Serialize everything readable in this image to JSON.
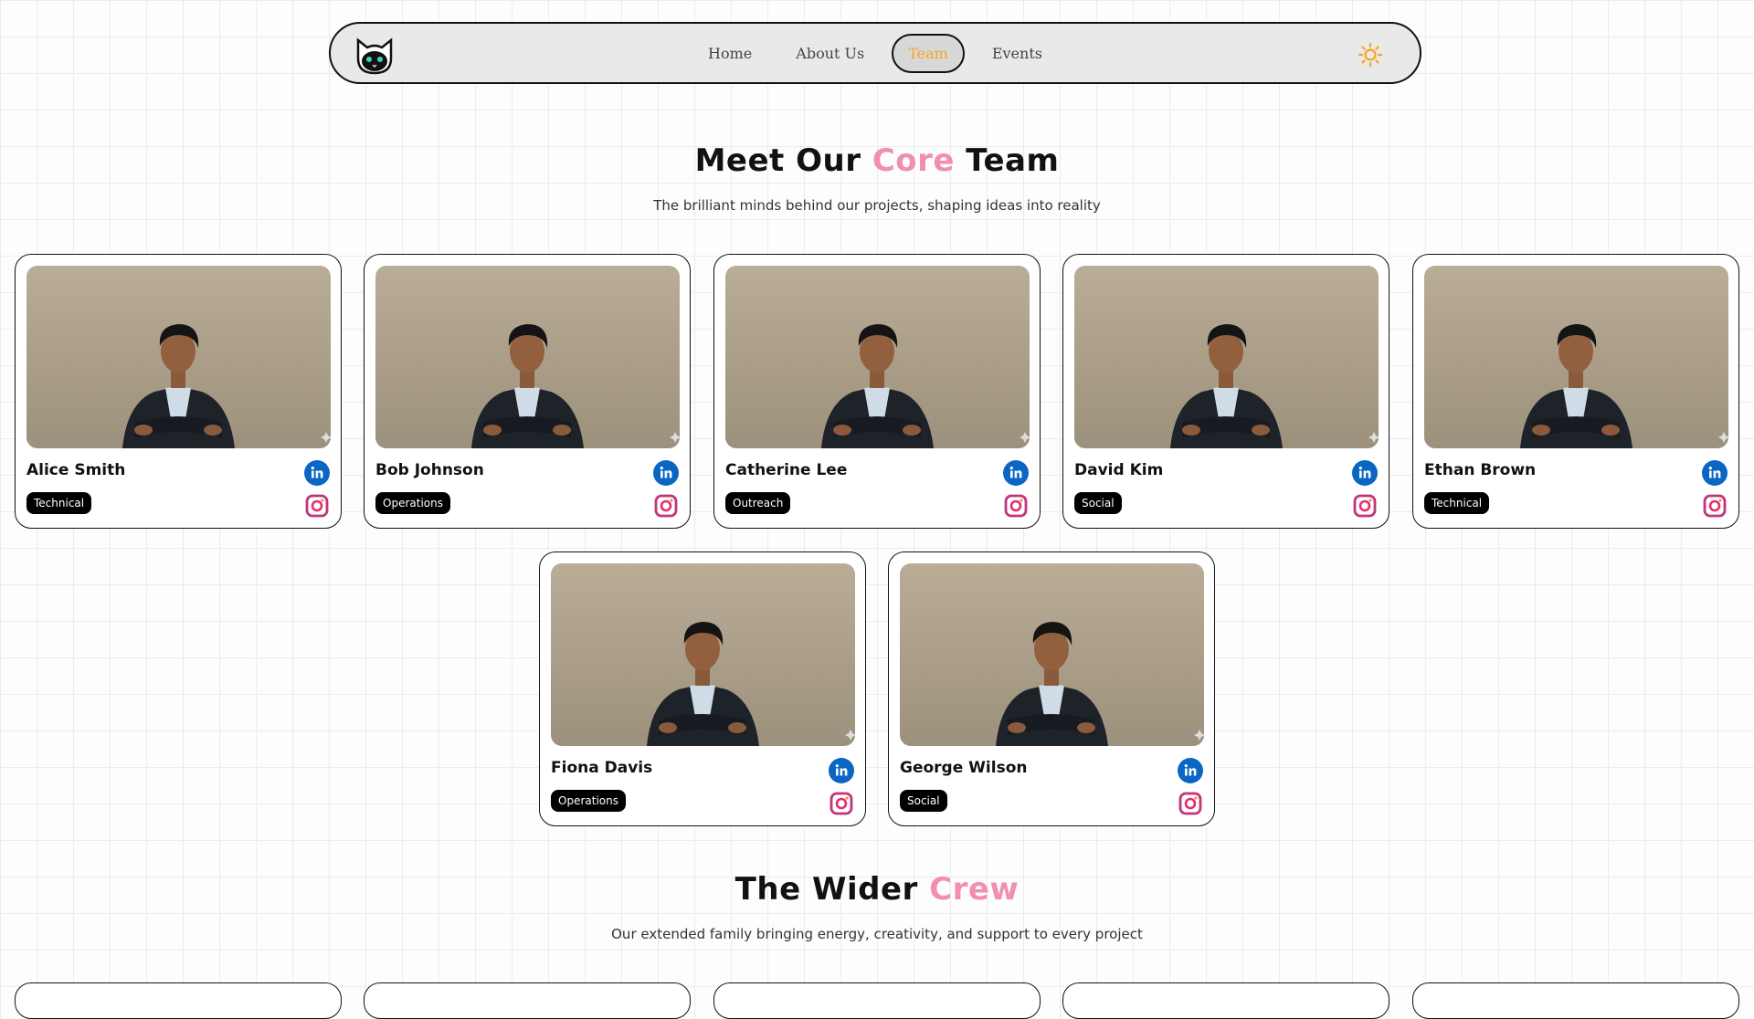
{
  "nav": {
    "logo": "cat-logo",
    "links": [
      "Home",
      "About Us",
      "Team",
      "Events"
    ],
    "active": "Team",
    "theme_icon": "sun-icon",
    "accent_color": "#f5a623"
  },
  "core": {
    "title_before": "Meet Our ",
    "title_accent": "Core",
    "title_after": " Team",
    "subtitle": "The brilliant minds behind our projects, shaping ideas into reality",
    "accent_color": "#f08fb0"
  },
  "members": [
    {
      "name": "Alice Smith",
      "role": "Technical"
    },
    {
      "name": "Bob Johnson",
      "role": "Operations"
    },
    {
      "name": "Catherine Lee",
      "role": "Outreach"
    },
    {
      "name": "David Kim",
      "role": "Social"
    },
    {
      "name": "Ethan Brown",
      "role": "Technical"
    },
    {
      "name": "Fiona Davis",
      "role": "Operations"
    },
    {
      "name": "George Wilson",
      "role": "Social"
    }
  ],
  "wider": {
    "title_before": "The Wider ",
    "title_accent": "Crew",
    "subtitle": "Our extended family bringing energy, creativity, and support to every project"
  },
  "icons": {
    "linkedin": "linkedin-icon",
    "instagram": "instagram-icon",
    "sparkle": "sparkle-icon"
  }
}
